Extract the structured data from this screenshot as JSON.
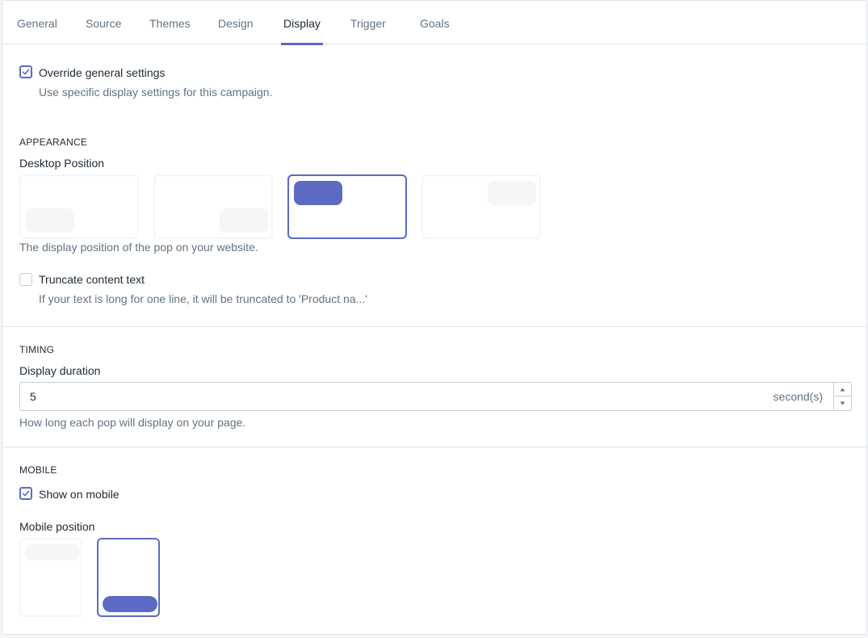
{
  "tabs": [
    {
      "label": "General"
    },
    {
      "label": "Source"
    },
    {
      "label": "Themes"
    },
    {
      "label": "Design"
    },
    {
      "label": "Display",
      "active": true
    },
    {
      "label": "Trigger"
    },
    {
      "label": "Goals"
    }
  ],
  "override": {
    "checked": true,
    "label": "Override general settings",
    "help": "Use specific display settings for this campaign."
  },
  "appearance": {
    "heading": "APPEARANCE",
    "desktop_position_label": "Desktop Position",
    "desktop_positions": [
      "bottom-left",
      "bottom-right",
      "top-left",
      "top-right"
    ],
    "desktop_selected": "top-left",
    "desktop_help": "The display position of the pop on your website.",
    "truncate": {
      "checked": false,
      "label": "Truncate content text",
      "help": "If your text is long for one line, it will be truncated to 'Product na...'"
    }
  },
  "timing": {
    "heading": "TIMING",
    "duration_label": "Display duration",
    "duration_value": "5",
    "duration_suffix": "second(s)",
    "duration_help": "How long each pop will display on your page."
  },
  "mobile": {
    "heading": "MOBILE",
    "show_on_mobile": {
      "checked": true,
      "label": "Show on mobile"
    },
    "position_label": "Mobile position",
    "positions": [
      "top",
      "bottom"
    ],
    "selected": "bottom"
  },
  "colors": {
    "accent": "#5c6ac4",
    "placeholder": "#f4f6f8",
    "border": "#dfe3e8",
    "subdued_text": "#637381"
  },
  "icons": {
    "checkmark": "checkmark-icon",
    "spinner_up": "caret-up-icon",
    "spinner_down": "caret-down-icon"
  }
}
